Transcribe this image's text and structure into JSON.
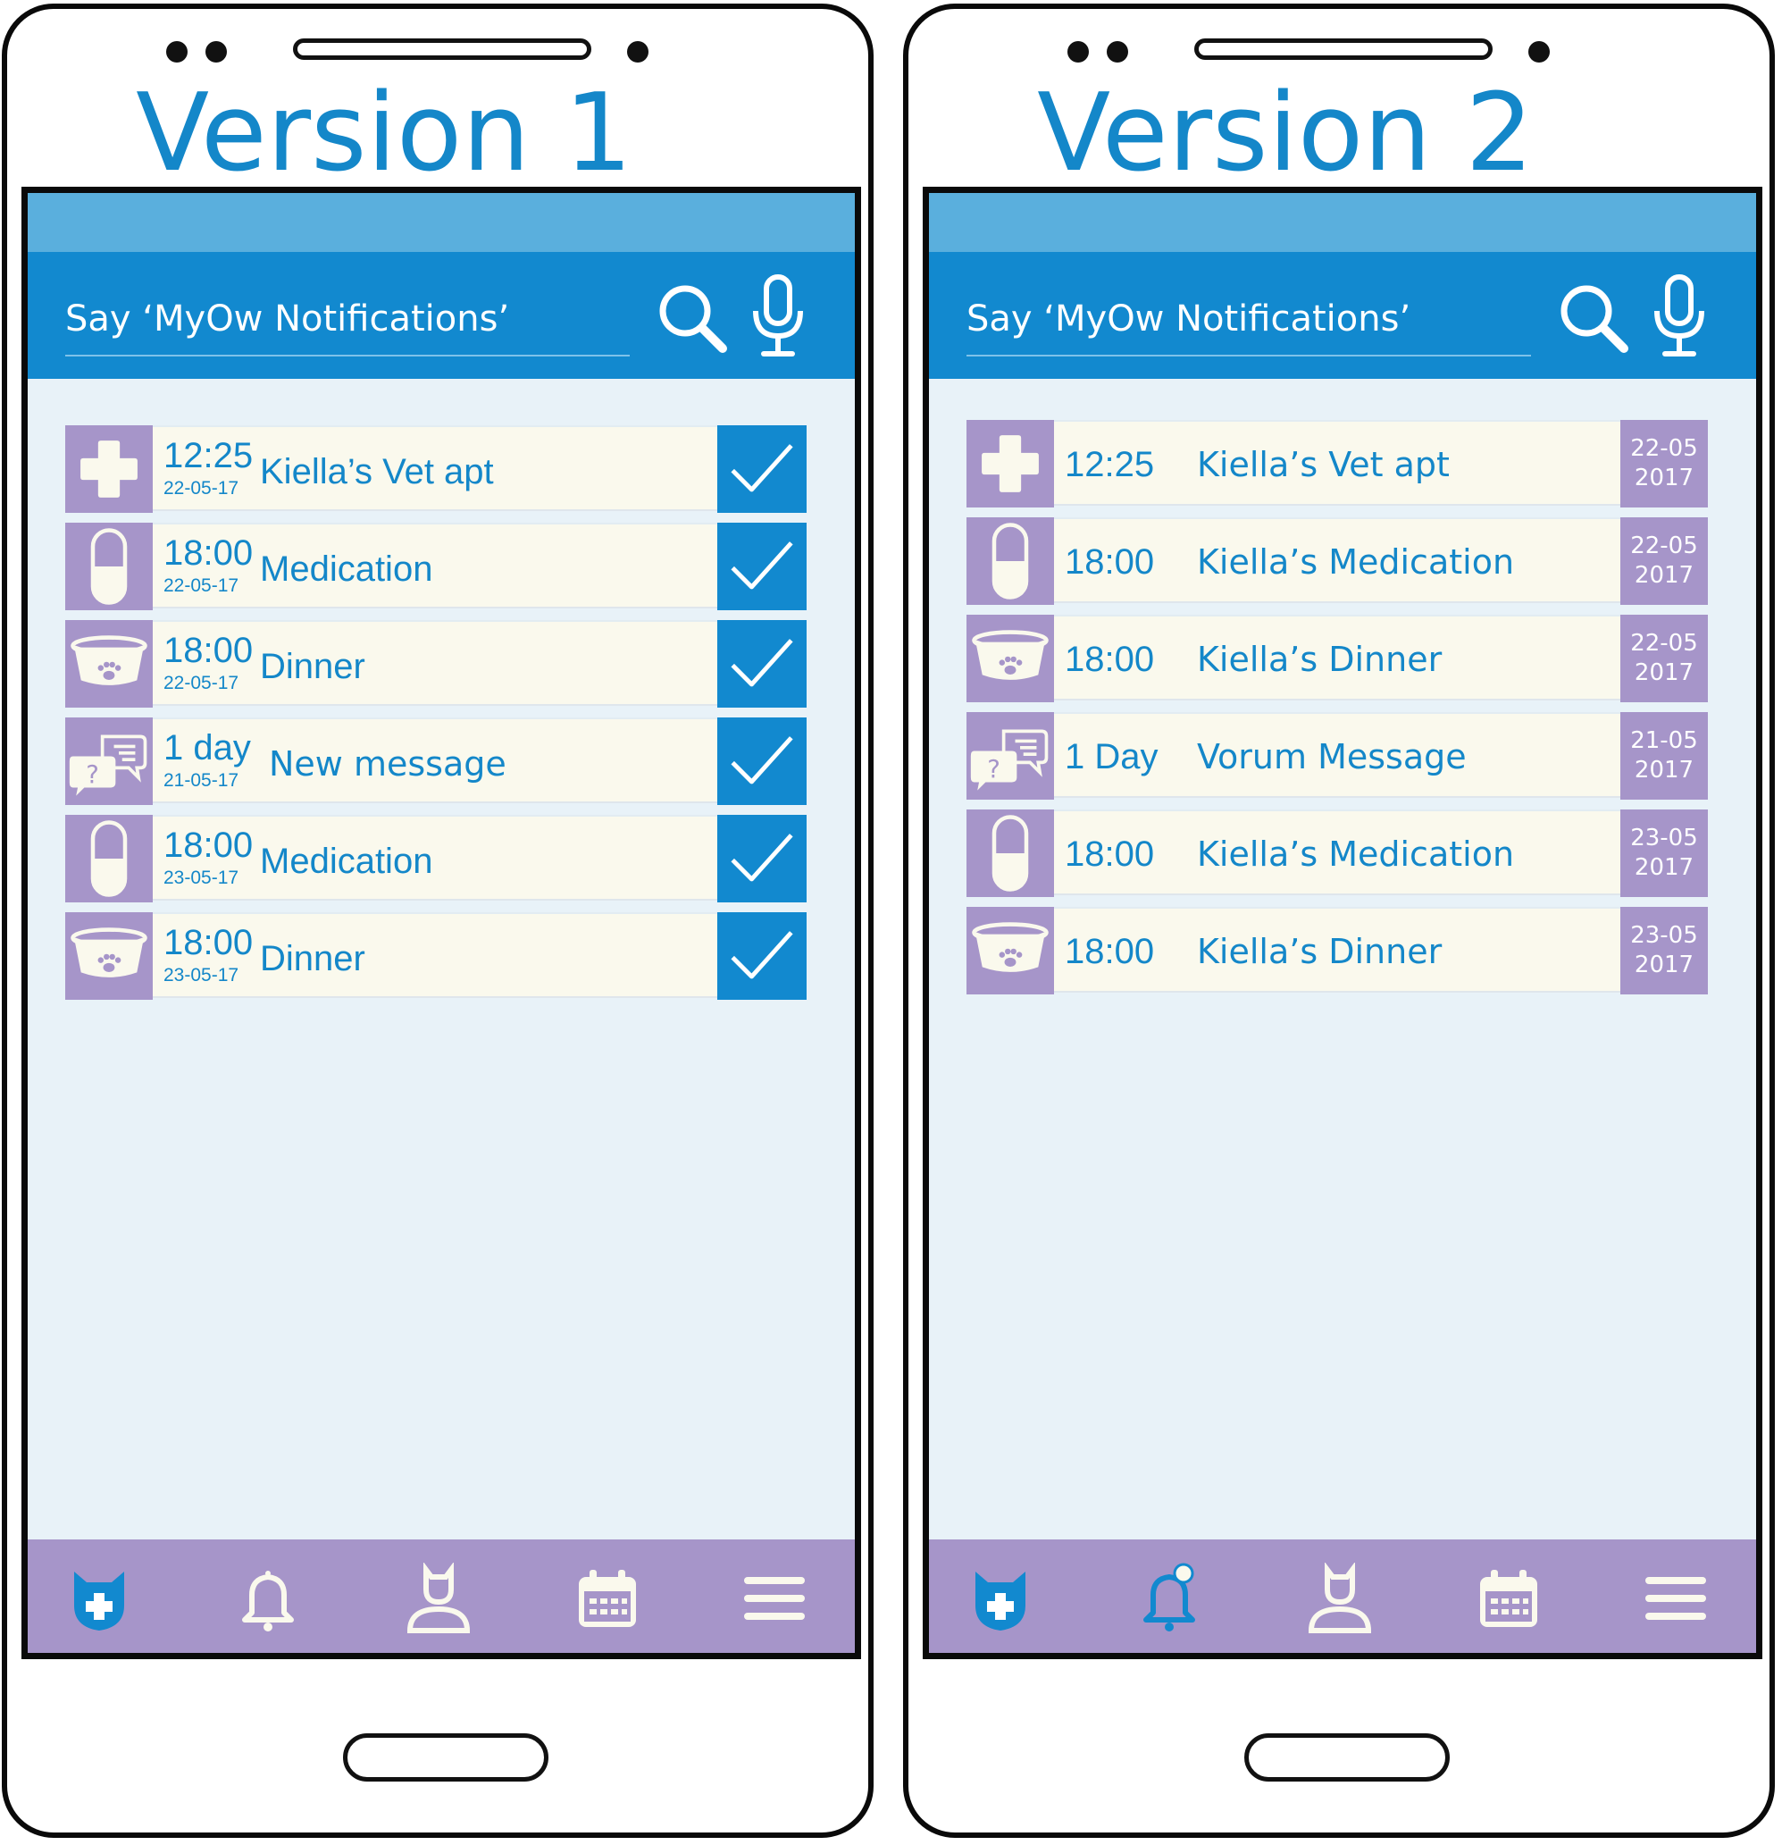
{
  "colors": {
    "accent_blue": "#1289cf",
    "title_blue": "#1487c9",
    "status_bar": "#5aafdd",
    "purple": "#a695c9",
    "row_bg": "#faf9ed",
    "screen_bg": "#e8f2f8"
  },
  "version1": {
    "title": "Version 1",
    "search_placeholder": "Say ‘MyOw Notifications’",
    "items": [
      {
        "icon": "medical-cross-icon",
        "time": "12:25",
        "date": "22-05-17",
        "label": "Kiella’s Vet apt"
      },
      {
        "icon": "pill-icon",
        "time": "18:00",
        "date": "22-05-17",
        "label": "Medication"
      },
      {
        "icon": "food-bowl-icon",
        "time": "18:00",
        "date": "22-05-17",
        "label": "Dinner"
      },
      {
        "icon": "chat-question-icon",
        "time": "1 day",
        "date": "21-05-17",
        "label": "New message"
      },
      {
        "icon": "pill-icon",
        "time": "18:00",
        "date": "23-05-17",
        "label": "Medication"
      },
      {
        "icon": "food-bowl-icon",
        "time": "18:00",
        "date": "23-05-17",
        "label": "Dinner"
      }
    ],
    "nav": [
      "pet-health-icon",
      "bell-icon",
      "profile-icon",
      "calendar-icon",
      "menu-icon"
    ]
  },
  "version2": {
    "title": "Version 2",
    "search_placeholder": "Say ‘MyOw Notifications’",
    "items": [
      {
        "icon": "medical-cross-icon",
        "time": "12:25",
        "label": "Kiella’s Vet apt",
        "date_line1": "22-05",
        "date_line2": "2017"
      },
      {
        "icon": "pill-icon",
        "time": "18:00",
        "label": "Kiella’s Medication",
        "date_line1": "22-05",
        "date_line2": "2017"
      },
      {
        "icon": "food-bowl-icon",
        "time": "18:00",
        "label": "Kiella’s Dinner",
        "date_line1": "22-05",
        "date_line2": "2017"
      },
      {
        "icon": "chat-question-icon",
        "time": "1 Day",
        "label": "Vorum Message",
        "date_line1": "21-05",
        "date_line2": "2017"
      },
      {
        "icon": "pill-icon",
        "time": "18:00",
        "label": "Kiella’s Medication",
        "date_line1": "23-05",
        "date_line2": "2017"
      },
      {
        "icon": "food-bowl-icon",
        "time": "18:00",
        "label": "Kiella’s Dinner",
        "date_line1": "23-05",
        "date_line2": "2017"
      }
    ],
    "nav": [
      "pet-health-icon",
      "bell-icon",
      "profile-icon",
      "calendar-icon",
      "menu-icon"
    ]
  }
}
